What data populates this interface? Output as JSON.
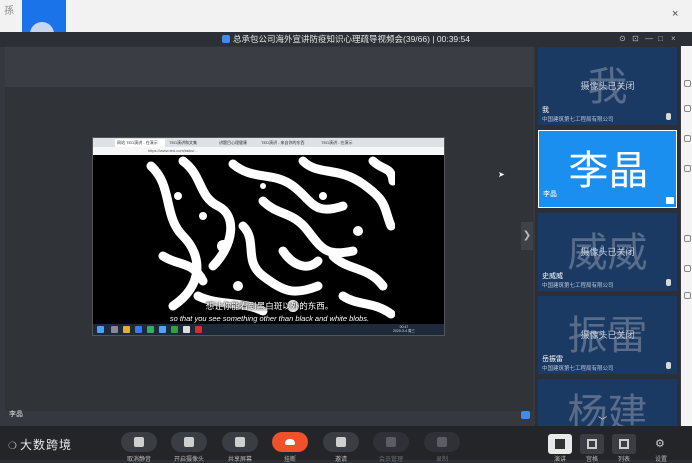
{
  "desktop": {
    "top_text": "孫",
    "close_glyph": "×"
  },
  "window": {
    "title": "总承包公司海外宣讲防疫知识心理疏导视频会(39/66) | 00:39:54",
    "controls": [
      "⊙",
      "⊡",
      "—",
      "□",
      "×"
    ]
  },
  "shared_screen": {
    "tabs": [
      "网站 TED演讲 - 在演示",
      "TED演讲和文集",
      "讲题目心理健康",
      "TED演讲 - 来自你的东西",
      "TED演讲 - 在演示"
    ],
    "url": "https://www.ted.com/talks/...",
    "subtitle_cn": "想让你能看到黑白斑以外的东西。",
    "subtitle_en": "so that you see something other than black and white blobs.",
    "clock": "00:47",
    "date": "2020-3-4 周三"
  },
  "speaker": {
    "name": "李晶"
  },
  "gallery": {
    "tiles": [
      {
        "big": "我",
        "status": "摄像头已关闭",
        "name": "我",
        "org": "中国建筑第七工程局有限公司",
        "active": false
      },
      {
        "big": "李晶",
        "status": "",
        "name": "李晶",
        "org": "",
        "active": true
      },
      {
        "big": "威威",
        "status": "摄像头已关闭",
        "name": "史威威",
        "org": "中国建筑第七工程局有限公司",
        "active": false
      },
      {
        "big": "振雷",
        "status": "摄像头已关闭",
        "name": "岳振雷",
        "org": "中国建筑第七工程局有限公司",
        "active": false
      },
      {
        "big": "杨建",
        "status": "",
        "name": "",
        "org": "",
        "active": false
      }
    ]
  },
  "brand": {
    "logo": "大数跨境"
  },
  "toolbar": {
    "buttons": [
      {
        "label": "取消静音",
        "icon": "mic-off-icon"
      },
      {
        "label": "开启摄像头",
        "icon": "camera-icon"
      },
      {
        "label": "共享屏幕",
        "icon": "screen-share-icon"
      },
      {
        "label": "挂断",
        "icon": "hangup-icon"
      },
      {
        "label": "邀请",
        "icon": "invite-icon"
      },
      {
        "label": "会员管理",
        "icon": "members-icon"
      },
      {
        "label": "录制",
        "icon": "record-icon"
      }
    ],
    "views": [
      {
        "label": "演讲",
        "selected": true
      },
      {
        "label": "宫格",
        "selected": false
      },
      {
        "label": "列表",
        "selected": false
      }
    ],
    "settings_label": "设置"
  },
  "colors": {
    "accent": "#1a8ff0",
    "hangup": "#f0502a",
    "tile_bg": "#1b3a63"
  }
}
